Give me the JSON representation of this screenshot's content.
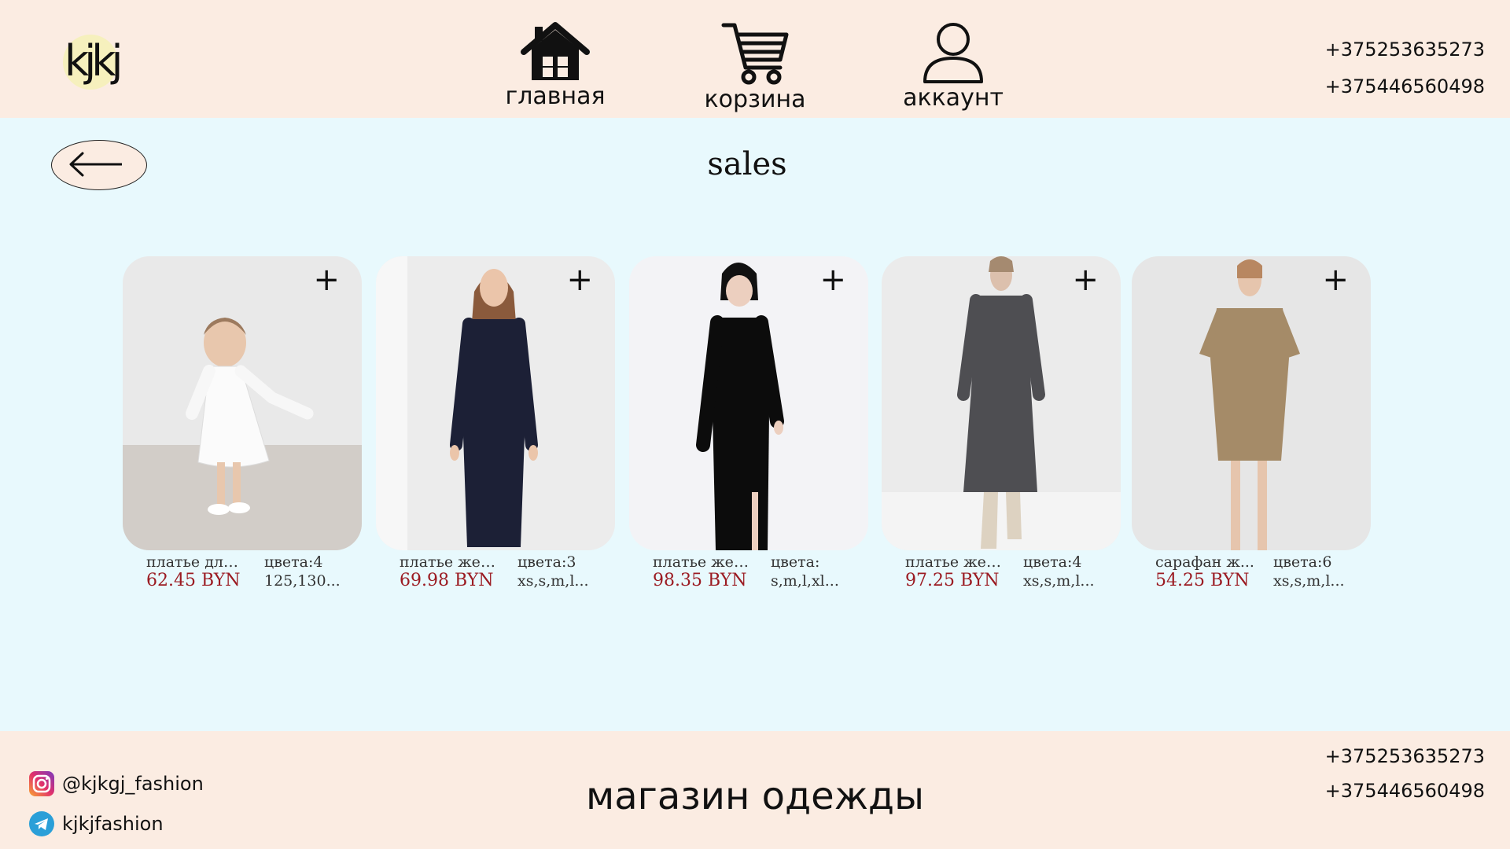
{
  "header": {
    "logo_text": "kjkj",
    "nav": [
      {
        "label": "главная",
        "icon": "home-icon"
      },
      {
        "label": "корзина",
        "icon": "cart-icon"
      },
      {
        "label": "аккаунт",
        "icon": "user-icon"
      }
    ],
    "phones": [
      "+375253635273",
      "+375446560498"
    ]
  },
  "page": {
    "title": "sales",
    "back_icon": "arrow-left-icon"
  },
  "products": [
    {
      "name": "платье для...",
      "price": "62.45 BYN",
      "colors": "цвета:4",
      "sizes": "125,130...",
      "image": "white-child-dress-photo",
      "add_icon": "plus-icon"
    },
    {
      "name": "платье жен...",
      "price": "69.98 BYN",
      "colors": "цвета:3",
      "sizes": "xs,s,m,l...",
      "image": "navy-hooded-dress-photo",
      "add_icon": "plus-icon"
    },
    {
      "name": "платье жен...",
      "price": "98.35 BYN",
      "colors": "цвета:",
      "sizes": "s,m,l,xl...",
      "image": "black-long-dress-photo",
      "add_icon": "plus-icon"
    },
    {
      "name": "платье жен...",
      "price": "97.25 BYN",
      "colors": "цвета:4",
      "sizes": "xs,s,m,l...",
      "image": "grey-knit-dress-photo",
      "add_icon": "plus-icon"
    },
    {
      "name": "сарафан ж...",
      "price": "54.25 BYN",
      "colors": "цвета:6",
      "sizes": "xs,s,m,l...",
      "image": "beige-dress-photo",
      "add_icon": "plus-icon"
    }
  ],
  "footer": {
    "title": "магазин одежды",
    "social": [
      {
        "icon": "instagram-icon",
        "handle": "@kjkgj_fashion"
      },
      {
        "icon": "telegram-icon",
        "handle": "kjkjfashion"
      }
    ],
    "phones": [
      "+375253635273",
      "+375446560498"
    ]
  },
  "colors": {
    "header_bg": "#fbece2",
    "page_bg": "#e8f9fd",
    "price": "#9b1b22"
  }
}
